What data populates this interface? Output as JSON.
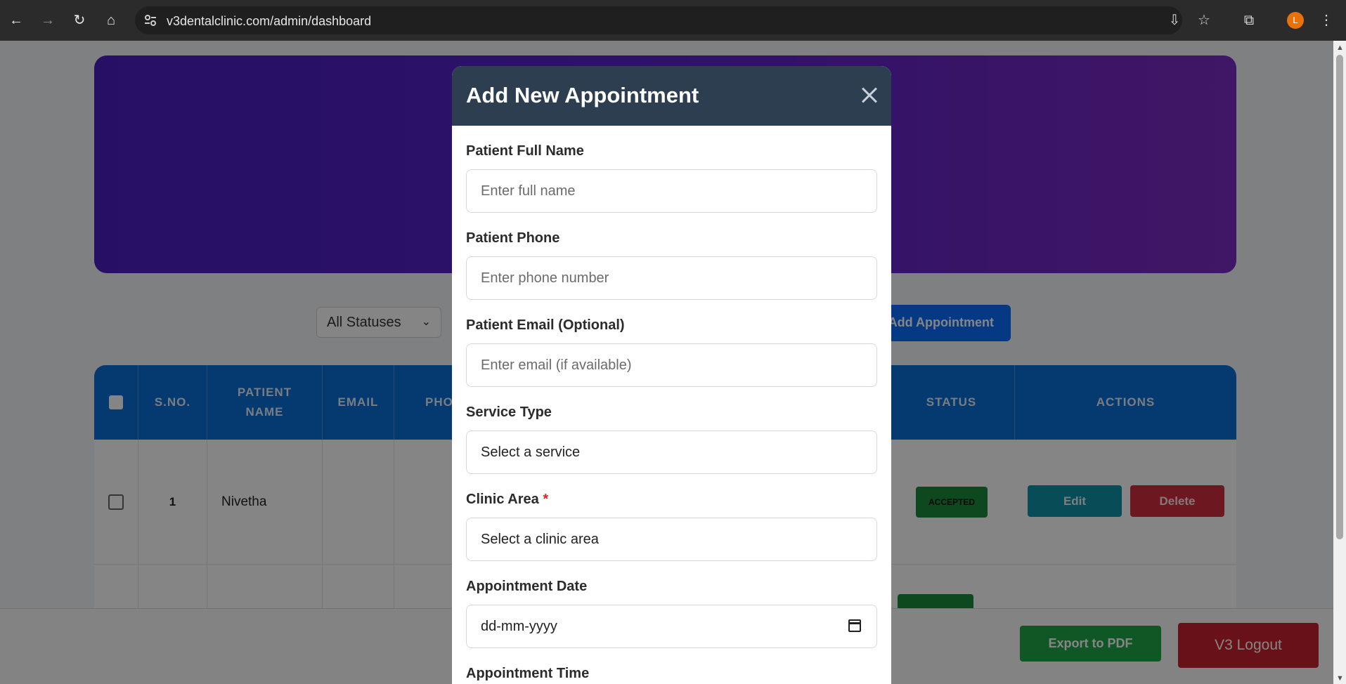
{
  "browser": {
    "url": "v3dentalclinic.com/admin/dashboard",
    "avatar_initial": "L"
  },
  "toolbar": {
    "status_filter": "All Statuses",
    "add_appointment_label": "Add Appointment"
  },
  "table": {
    "headers": [
      "S.NO.",
      "PATIENT NAME",
      "EMAIL",
      "PHO",
      "STATUS",
      "ACTIONS"
    ],
    "rows": [
      {
        "sno": "1",
        "patient_name": "Nivetha",
        "status": "ACCEPTED",
        "edit": "Edit",
        "delete": "Delete"
      }
    ]
  },
  "footer": {
    "export_label": "Export to PDF",
    "logout_label": "V3 Logout"
  },
  "modal": {
    "title": "Add New Appointment",
    "fields": {
      "name": {
        "label": "Patient Full Name",
        "placeholder": "Enter full name"
      },
      "phone": {
        "label": "Patient Phone",
        "placeholder": "Enter phone number"
      },
      "email": {
        "label": "Patient Email (Optional)",
        "placeholder": "Enter email (if available)"
      },
      "service": {
        "label": "Service Type",
        "value": "Select a service"
      },
      "area": {
        "label": "Clinic Area",
        "required": "*",
        "value": "Select a clinic area"
      },
      "date": {
        "label": "Appointment Date",
        "value": "dd-mm-yyyy"
      },
      "time": {
        "label": "Appointment Time"
      }
    }
  },
  "colors": {
    "header_blue": "#0a6fd8",
    "modal_header": "#2c3e50",
    "accepted_green": "#1a8a3a",
    "delete_red": "#d12f3e",
    "edit_teal": "#1193a8"
  }
}
